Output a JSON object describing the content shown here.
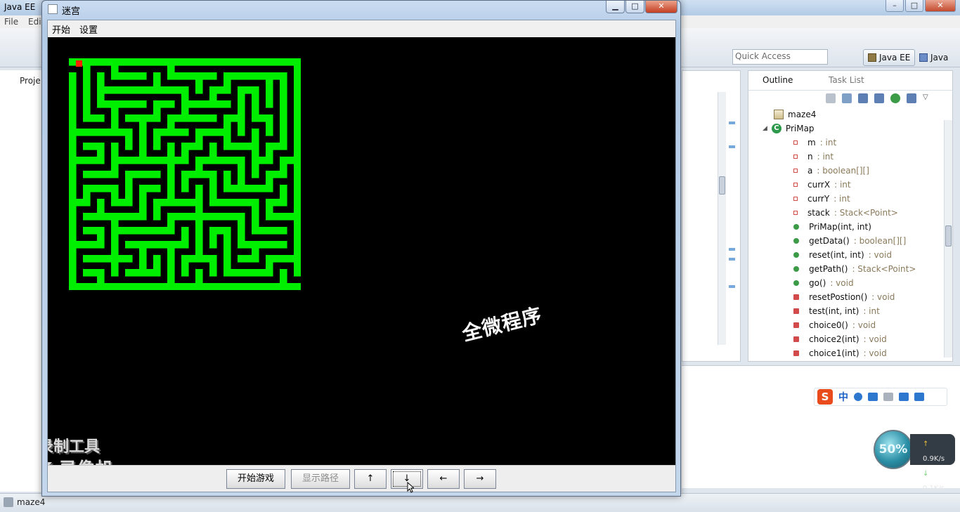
{
  "ide": {
    "title": "Java EE",
    "menu": [
      "File",
      "Edi"
    ],
    "quick_access_placeholder": "Quick Access",
    "perspectives": [
      "Java EE",
      "Java"
    ],
    "left_tab": "Proje",
    "status_text": "maze4"
  },
  "outline": {
    "tab_active": "Outline",
    "tab_inactive": "Task List",
    "package": "maze4",
    "class_name": "PriMap",
    "members": [
      {
        "name": "m",
        "type": " : int",
        "kind": "field"
      },
      {
        "name": "n",
        "type": " : int",
        "kind": "field"
      },
      {
        "name": "a",
        "type": " : boolean[][]",
        "kind": "field"
      },
      {
        "name": "currX",
        "type": " : int",
        "kind": "field"
      },
      {
        "name": "currY",
        "type": " : int",
        "kind": "field"
      },
      {
        "name": "stack",
        "type": " : Stack<Point>",
        "kind": "field"
      },
      {
        "name": "PriMap(int, int)",
        "type": "",
        "kind": "constructor"
      },
      {
        "name": "getData()",
        "type": " : boolean[][]",
        "kind": "method-pub"
      },
      {
        "name": "reset(int, int)",
        "type": " : void",
        "kind": "method-pub"
      },
      {
        "name": "getPath()",
        "type": " : Stack<Point>",
        "kind": "method-pub"
      },
      {
        "name": "go()",
        "type": " : void",
        "kind": "method-pub"
      },
      {
        "name": "resetPostion()",
        "type": " : void",
        "kind": "method-priv"
      },
      {
        "name": "test(int, int)",
        "type": " : int",
        "kind": "method-priv"
      },
      {
        "name": "choice0()",
        "type": " : void",
        "kind": "method-priv"
      },
      {
        "name": "choice2(int)",
        "type": " : void",
        "kind": "method-priv"
      },
      {
        "name": "choice1(int)",
        "type": " : void",
        "kind": "method-priv"
      }
    ]
  },
  "ime": {
    "s_label": "S",
    "zh_label": "中"
  },
  "network": {
    "percent": "50%",
    "up": "0.9K/s",
    "down": "0.1K/s"
  },
  "maze_window": {
    "title": "迷宫",
    "menu": [
      "开始",
      "设置"
    ],
    "watermark": "全微程序",
    "rec_line1": "录制工具",
    "rec_line2": "KK 录像机",
    "buttons": [
      {
        "label": "开始游戏",
        "enabled": true
      },
      {
        "label": "显示路径",
        "enabled": false
      },
      {
        "label": "↑",
        "enabled": true
      },
      {
        "label": "↓",
        "enabled": true
      },
      {
        "label": "←",
        "enabled": true
      },
      {
        "label": "→",
        "enabled": true
      }
    ]
  },
  "colors": {
    "maze_wall": "#00ee00",
    "maze_player": "#ff2200",
    "maze_background": "#000000"
  }
}
